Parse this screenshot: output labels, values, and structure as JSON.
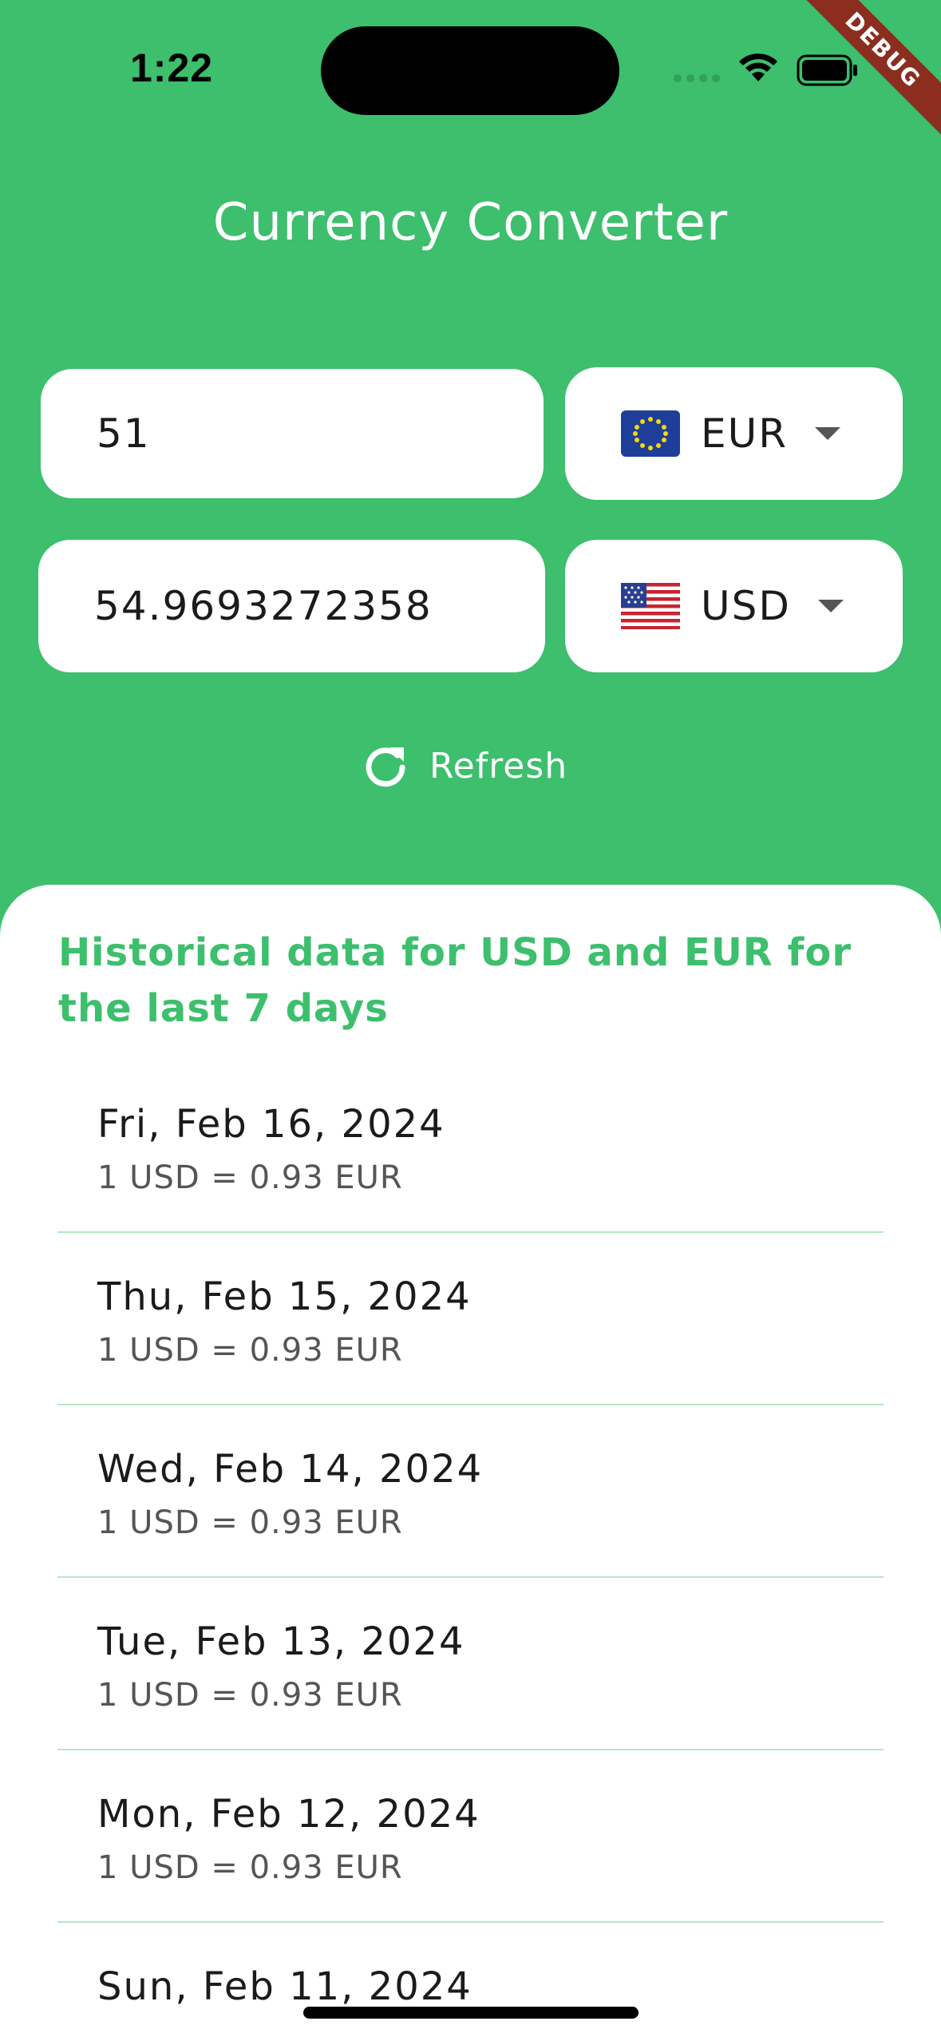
{
  "status_bar": {
    "time": "1:22",
    "debug_label": "DEBUG"
  },
  "app": {
    "title": "Currency Converter"
  },
  "converter": {
    "from": {
      "amount": "51",
      "currency": "EUR",
      "flag_icon": "eu-flag-icon"
    },
    "to": {
      "amount": "54.9693272358",
      "currency": "USD",
      "flag_icon": "us-flag-icon"
    },
    "refresh_label": "Refresh"
  },
  "history": {
    "heading": "Historical data for USD and EUR for the last 7 days",
    "items": [
      {
        "date": "Fri, Feb 16, 2024",
        "rate": "1 USD = 0.93 EUR"
      },
      {
        "date": "Thu, Feb 15, 2024",
        "rate": "1 USD = 0.93 EUR"
      },
      {
        "date": "Wed, Feb 14, 2024",
        "rate": "1 USD = 0.93 EUR"
      },
      {
        "date": "Tue, Feb 13, 2024",
        "rate": "1 USD = 0.93 EUR"
      },
      {
        "date": "Mon, Feb 12, 2024",
        "rate": "1 USD = 0.93 EUR"
      },
      {
        "date": "Sun, Feb 11, 2024",
        "rate": ""
      }
    ]
  },
  "colors": {
    "accent": "#3dbf6d",
    "debug_ribbon": "#8b2e20"
  }
}
